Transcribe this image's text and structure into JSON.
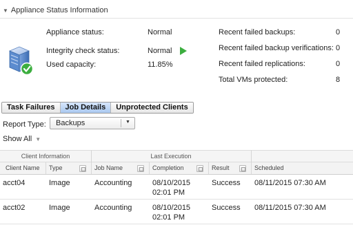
{
  "section": {
    "title": "Appliance Status Information"
  },
  "status": {
    "appliance_status_label": "Appliance status:",
    "appliance_status_value": "Normal",
    "integrity_label": "Integrity check status:",
    "integrity_value": "Normal",
    "used_capacity_label": "Used capacity:",
    "used_capacity_value": "11.85%"
  },
  "stats": {
    "failed_backups_label": "Recent failed backups:",
    "failed_backups_value": "0",
    "failed_verifications_label": "Recent failed backup verifications:",
    "failed_verifications_value": "0",
    "failed_replications_label": "Recent failed replications:",
    "failed_replications_value": "0",
    "total_vms_label": "Total VMs protected:",
    "total_vms_value": "8"
  },
  "tabs": [
    {
      "label": "Task Failures"
    },
    {
      "label": "Job Details"
    },
    {
      "label": "Unprotected Clients"
    }
  ],
  "active_tab": "Job Details",
  "report": {
    "label": "Report Type:",
    "selected": "Backups"
  },
  "show_all": {
    "label": "Show All"
  },
  "table": {
    "groups": {
      "client_info": "Client Information",
      "last_execution": "Last Execution"
    },
    "columns": {
      "client_name": "Client Name",
      "type": "Type",
      "job_name": "Job Name",
      "completion": "Completion",
      "result": "Result",
      "scheduled": "Scheduled"
    },
    "rows": [
      {
        "client_name": "acct04",
        "type": "Image",
        "job_name": "Accounting",
        "completion_date": "08/10/2015",
        "completion_time": "02:01 PM",
        "result": "Success",
        "scheduled": "08/11/2015 07:30 AM"
      },
      {
        "client_name": "acct02",
        "type": "Image",
        "job_name": "Accounting",
        "completion_date": "08/10/2015",
        "completion_time": "02:01 PM",
        "result": "Success",
        "scheduled": "08/11/2015 07:30 AM"
      }
    ]
  },
  "colors": {
    "accent_green": "#3cae3f",
    "tab_active": "#b7d2f4",
    "server_blue": "#4c7fc5"
  },
  "icons": {
    "appliance": "server-check-icon",
    "integrity": "play-icon",
    "collapse": "triangle-down-icon",
    "filter": "funnel-icon",
    "dropdown": "chevron-down-icon"
  }
}
